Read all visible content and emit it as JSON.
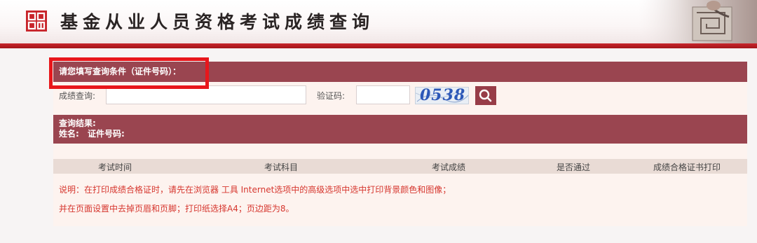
{
  "header": {
    "title": "基金从业人员资格考试成绩查询",
    "logo_icon": "seal-logo-icon",
    "art_icon": "handwriting-art-icon"
  },
  "colors": {
    "accent": "#9a4550",
    "red_bar": "#c8252b",
    "highlight": "#e8161b",
    "note_text": "#d6362e"
  },
  "panel": {
    "title": "请您填写查询条件（证件号码）：",
    "query_label": "成绩查询:",
    "query_value": "",
    "captcha_label": "验证码:",
    "captcha_value": "",
    "captcha_image_text": "0538",
    "search_icon": "search-icon",
    "result_title": "查询结果:",
    "name_label": "姓名:",
    "id_label": "证件号码:"
  },
  "table": {
    "columns": [
      "考试时间",
      "考试科目",
      "考试成绩",
      "是否通过",
      "成绩合格证书打印"
    ]
  },
  "notes": [
    "说明：在打印成绩合格证时，请先在浏览器 工具 Internet选项中的高级选项中选中打印背景颜色和图像；",
    "并在页面设置中去掉页眉和页脚；打印纸选择A4；页边距为8。"
  ]
}
